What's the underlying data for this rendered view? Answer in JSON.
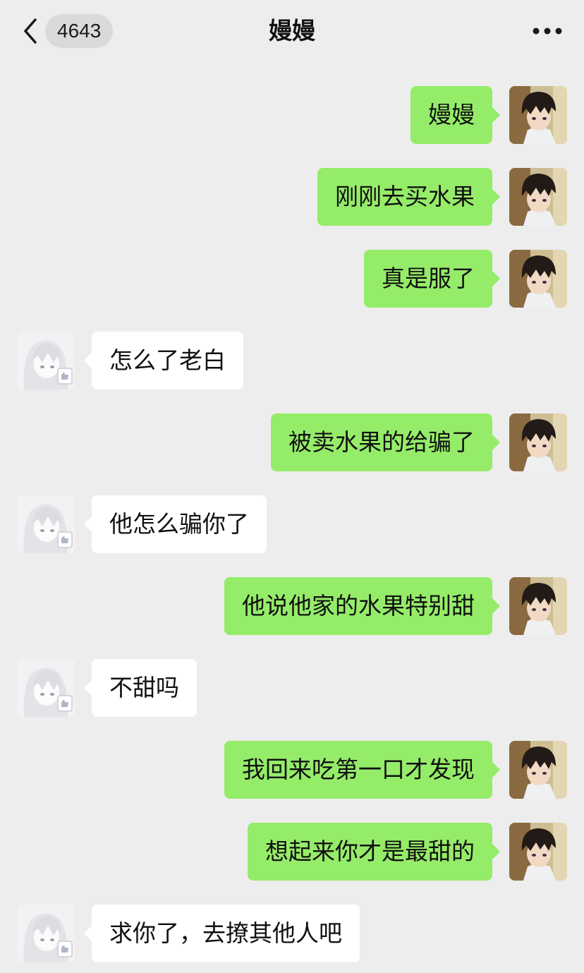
{
  "header": {
    "back_icon": "chevron-left-icon",
    "unread_count": "4643",
    "title": "嫚嫚",
    "more_icon": "more-dots-icon"
  },
  "colors": {
    "background": "#ededed",
    "sent_bubble": "#95ec69",
    "received_bubble": "#ffffff"
  },
  "messages": [
    {
      "sender": "me",
      "text": "嫚嫚"
    },
    {
      "sender": "me",
      "text": "刚刚去买水果"
    },
    {
      "sender": "me",
      "text": "真是服了"
    },
    {
      "sender": "other",
      "text": "怎么了老白"
    },
    {
      "sender": "me",
      "text": "被卖水果的给骗了"
    },
    {
      "sender": "other",
      "text": "他怎么骗你了"
    },
    {
      "sender": "me",
      "text": "他说他家的水果特别甜"
    },
    {
      "sender": "other",
      "text": "不甜吗"
    },
    {
      "sender": "me",
      "text": "我回来吃第一口才发现"
    },
    {
      "sender": "me",
      "text": "想起来你才是最甜的"
    },
    {
      "sender": "other",
      "text": "求你了，去撩其他人吧"
    }
  ]
}
